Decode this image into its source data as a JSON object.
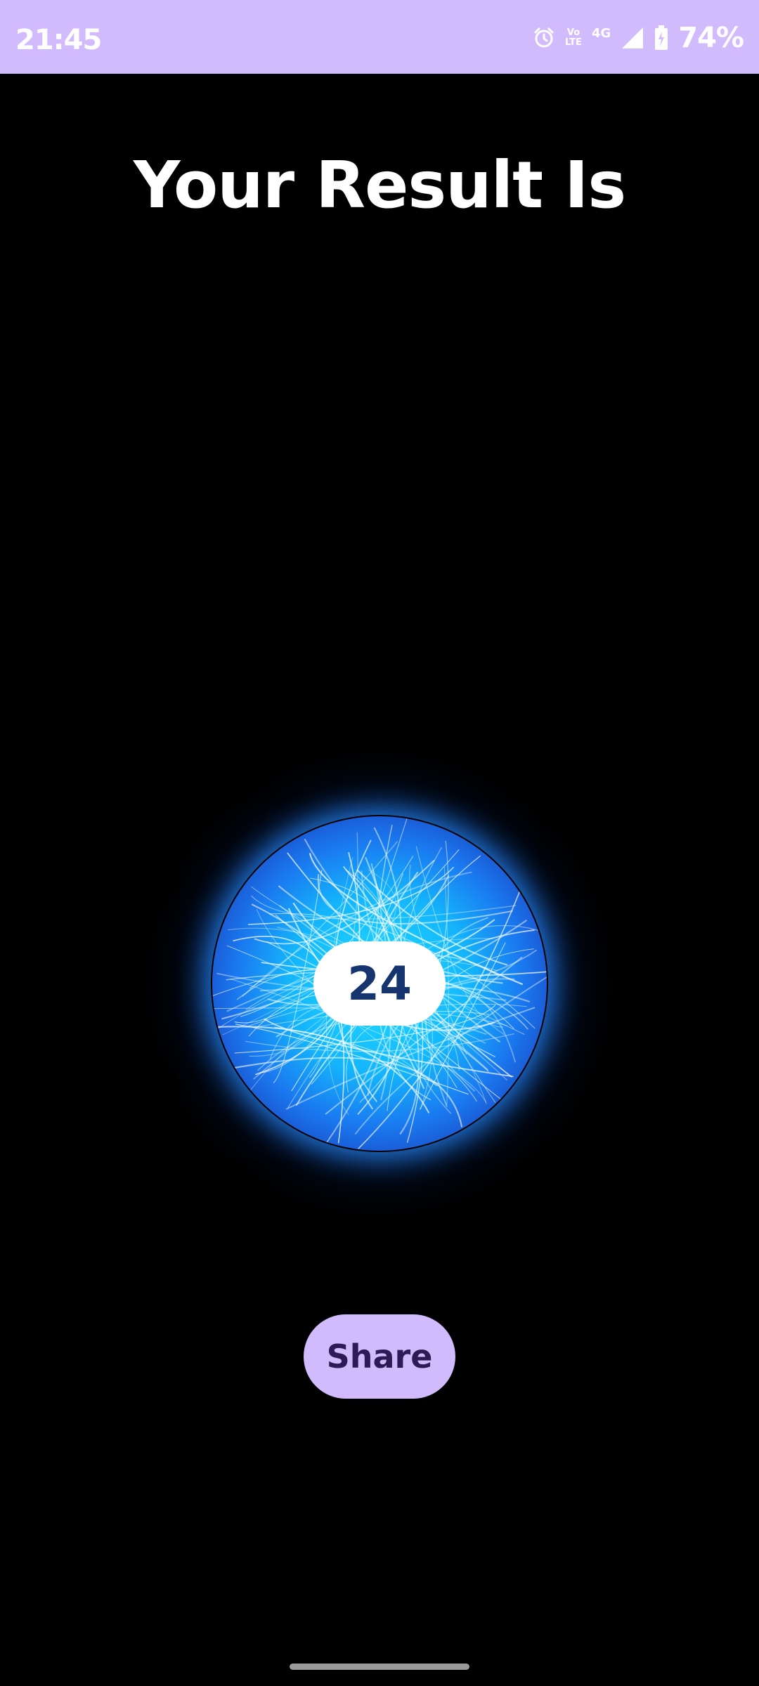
{
  "status_bar": {
    "time": "21:45",
    "volte_top": "Vo",
    "volte_bottom": "LTE",
    "network": "4G",
    "battery": "74%",
    "icons": [
      "alarm-icon",
      "volte-icon",
      "signal-icon",
      "battery-icon"
    ]
  },
  "page": {
    "title": "Your Result Is"
  },
  "result": {
    "value": "24"
  },
  "actions": {
    "share_label": "Share"
  },
  "colors": {
    "status_bar_bg": "#d2bbfc",
    "background": "#000000",
    "orb_core": "#1fd0ff",
    "orb_edge": "#1a6ff0",
    "result_text": "#16356e",
    "button_bg": "#d2bbfc",
    "button_text": "#2d1b55"
  }
}
